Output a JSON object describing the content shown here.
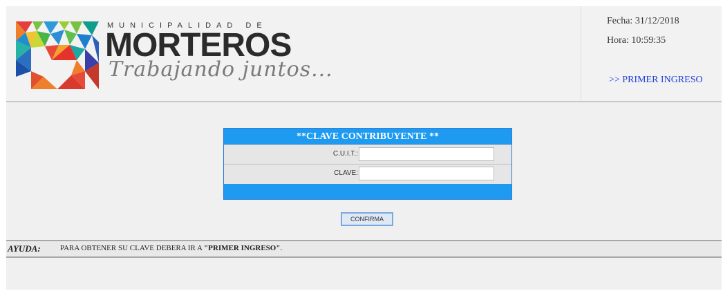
{
  "header": {
    "brand_top": "MUNICIPALIDAD DE",
    "brand_main": "MORTEROS",
    "brand_sub": "Trabajando juntos...",
    "fecha": "Fecha: 31/12/2018",
    "hora": "Hora: 10:59:35",
    "first_login_link": ">> PRIMER INGRESO"
  },
  "form": {
    "title": "**CLAVE CONTRIBUYENTE **",
    "cuit_label": "C.U.I.T.:",
    "clave_label": "CLAVE:",
    "cuit_value": "",
    "clave_value": ""
  },
  "actions": {
    "confirm_label": "CONFIRMA"
  },
  "help": {
    "label": "AYUDA:",
    "text_prefix": "PARA OBTENER SU CLAVE DEBERA IR A ",
    "text_emphasis": "\"PRIMER INGRESO\"",
    "text_suffix": "."
  },
  "colors": {
    "header_bar": "#1e9bf0",
    "link": "#1f3fd6"
  },
  "icons": {
    "logo": "morteros-municipal-logo"
  }
}
